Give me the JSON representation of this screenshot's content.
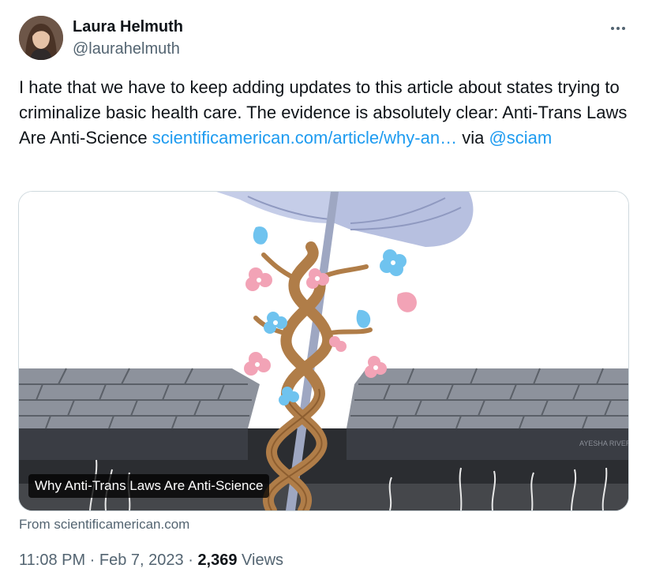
{
  "author": {
    "name": "Laura Helmuth",
    "handle": "@laurahelmuth",
    "avatar_icon": "avatar-portrait"
  },
  "more_icon": "more-dots-icon",
  "tweet": {
    "text_part1": "I hate that we have to keep adding updates to this article about states trying to criminalize basic health care. The evidence is absolutely clear: Anti-Trans Laws Are Anti-Science ",
    "link_text": "scientificamerican.com/article/why-an…",
    "text_part2": " via ",
    "mention": "@sciam"
  },
  "card": {
    "title": "Why Anti-Trans Laws Are Anti-Science",
    "domain": "From scientificamerican.com",
    "image_signature": "AYESHA RIVERA"
  },
  "meta": {
    "time": "11:08 PM",
    "separator": " · ",
    "date": "Feb 7, 2023",
    "views_count": "2,369",
    "views_label": " Views"
  },
  "colors": {
    "link": "#1d9bf0",
    "secondary_text": "#536471",
    "border": "#cfd9de",
    "bricks": "#686e7a",
    "staff_wood": "#b07d48",
    "flower_pink": "#f2a3b6",
    "flower_blue": "#6fc3ef",
    "wings": "#b7c0e0"
  }
}
